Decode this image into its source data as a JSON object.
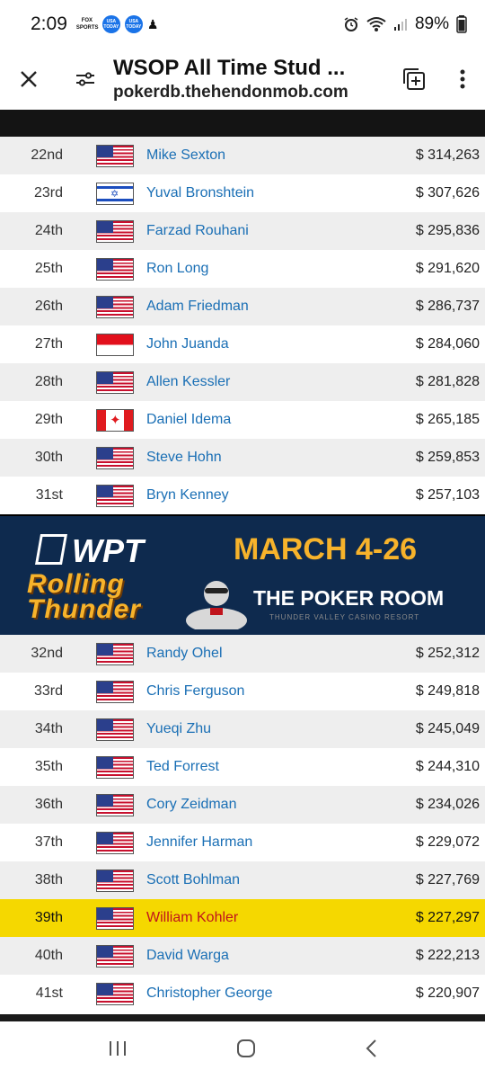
{
  "status_bar": {
    "time": "2:09",
    "badges": [
      "FOX SPORTS",
      "USA TODAY",
      "USA TODAY"
    ],
    "battery": "89%"
  },
  "browser": {
    "title": "WSOP All Time Stud ...",
    "url": "pokerdb.thehendonmob.com"
  },
  "rows_top": [
    {
      "rank": "22nd",
      "flag": "us",
      "name": "Mike Sexton",
      "money": "$ 314,263"
    },
    {
      "rank": "23rd",
      "flag": "il",
      "name": "Yuval Bronshtein",
      "money": "$ 307,626"
    },
    {
      "rank": "24th",
      "flag": "us",
      "name": "Farzad Rouhani",
      "money": "$ 295,836"
    },
    {
      "rank": "25th",
      "flag": "us",
      "name": "Ron Long",
      "money": "$ 291,620"
    },
    {
      "rank": "26th",
      "flag": "us",
      "name": "Adam Friedman",
      "money": "$ 286,737"
    },
    {
      "rank": "27th",
      "flag": "id",
      "name": "John Juanda",
      "money": "$ 284,060"
    },
    {
      "rank": "28th",
      "flag": "us",
      "name": "Allen Kessler",
      "money": "$ 281,828"
    },
    {
      "rank": "29th",
      "flag": "ca",
      "name": "Daniel Idema",
      "money": "$ 265,185"
    },
    {
      "rank": "30th",
      "flag": "us",
      "name": "Steve Hohn",
      "money": "$ 259,853"
    },
    {
      "rank": "31st",
      "flag": "us",
      "name": "Bryn Kenney",
      "money": "$ 257,103"
    }
  ],
  "ad": {
    "brand": "WPT",
    "event": "Rolling Thunder",
    "dates": "MARCH 4-26",
    "room": "THE POKER ROOM",
    "venue": "THUNDER VALLEY CASINO RESORT"
  },
  "rows_bottom": [
    {
      "rank": "32nd",
      "flag": "us",
      "name": "Randy Ohel",
      "money": "$ 252,312"
    },
    {
      "rank": "33rd",
      "flag": "us",
      "name": "Chris Ferguson",
      "money": "$ 249,818"
    },
    {
      "rank": "34th",
      "flag": "us",
      "name": "Yueqi Zhu",
      "money": "$ 245,049"
    },
    {
      "rank": "35th",
      "flag": "us",
      "name": "Ted Forrest",
      "money": "$ 244,310"
    },
    {
      "rank": "36th",
      "flag": "us",
      "name": "Cory Zeidman",
      "money": "$ 234,026"
    },
    {
      "rank": "37th",
      "flag": "us",
      "name": "Jennifer Harman",
      "money": "$ 229,072"
    },
    {
      "rank": "38th",
      "flag": "us",
      "name": "Scott Bohlman",
      "money": "$ 227,769"
    },
    {
      "rank": "39th",
      "flag": "us",
      "name": "William Kohler",
      "money": "$ 227,297",
      "highlighted": true
    },
    {
      "rank": "40th",
      "flag": "us",
      "name": "David Warga",
      "money": "$ 222,213"
    },
    {
      "rank": "41st",
      "flag": "us",
      "name": "Christopher George",
      "money": "$ 220,907"
    }
  ],
  "colors": {
    "link": "#1a6fb5",
    "highlight_bg": "#f5d800",
    "highlight_text": "#c0141c",
    "ad_bg": "#0e2a4e",
    "ad_gold": "#f7b32b"
  }
}
